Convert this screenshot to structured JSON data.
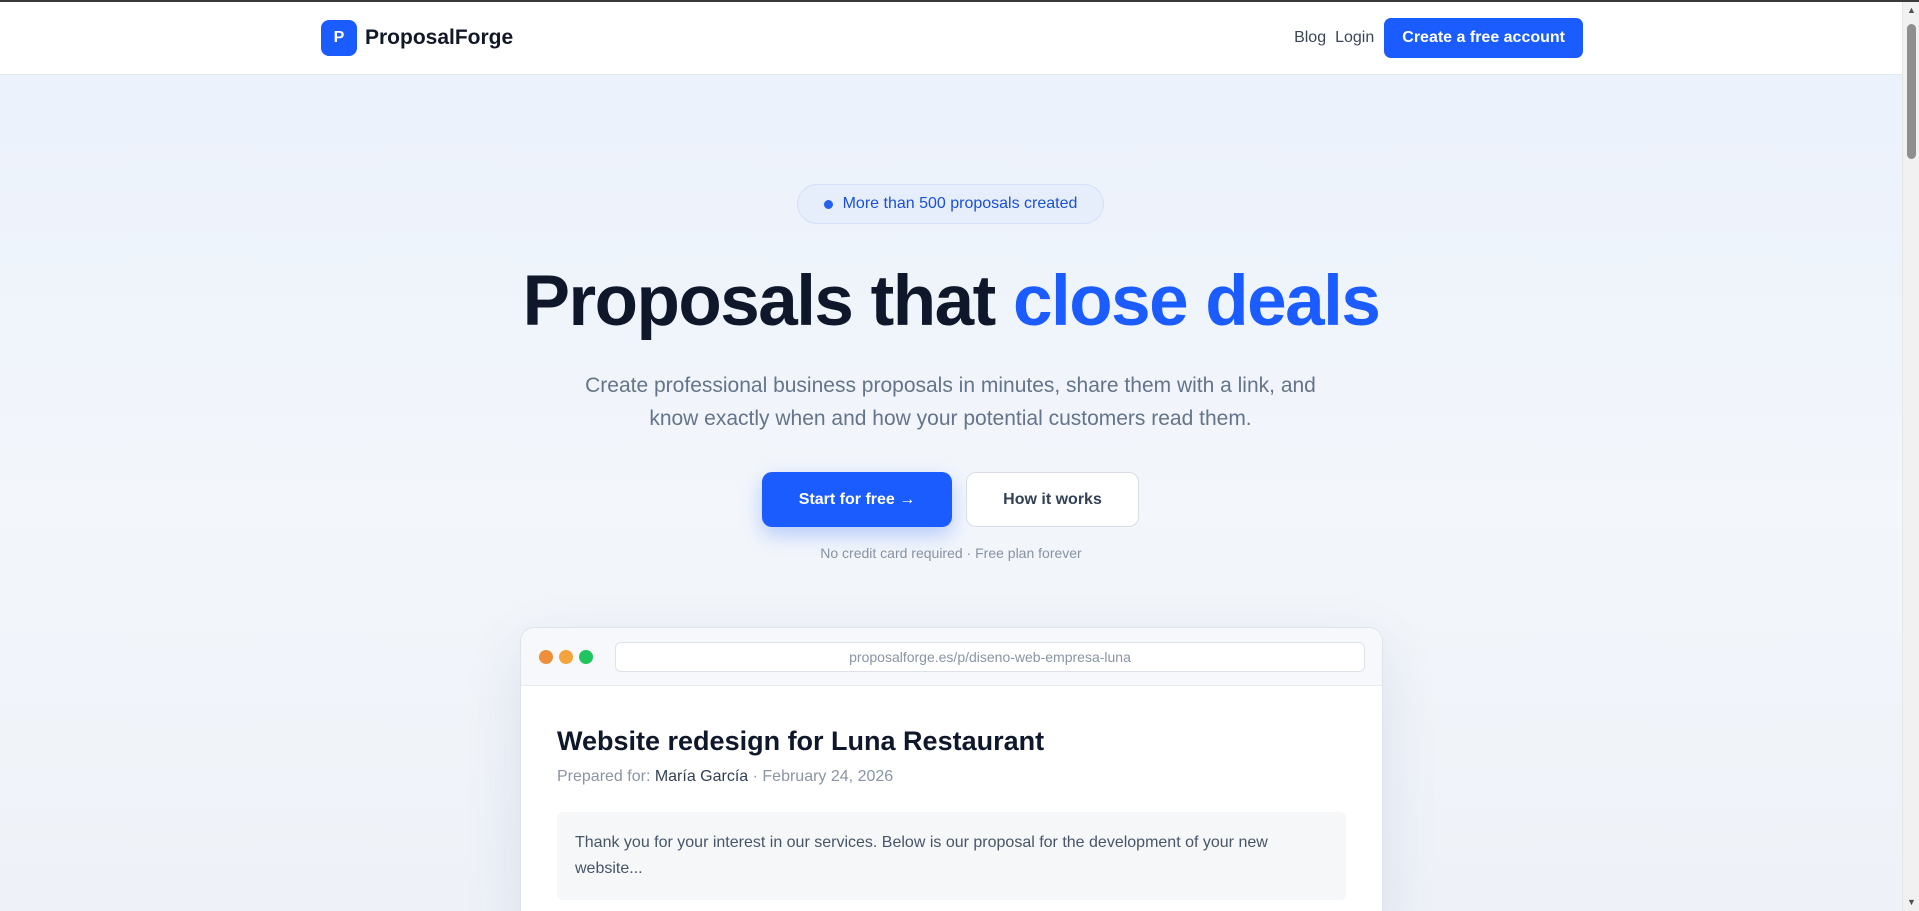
{
  "header": {
    "logo_letter": "P",
    "brand": "ProposalForge",
    "nav": {
      "blog": "Blog",
      "login": "Login",
      "cta": "Create a free account"
    }
  },
  "hero": {
    "badge": "More than 500 proposals created",
    "headline_main": "Proposals that ",
    "headline_accent": "close deals",
    "subtitle": "Create professional business proposals in minutes, share them with a link, and know exactly when and how your potential customers read them.",
    "primary_button": "Start for free →",
    "secondary_button": "How it works",
    "fineprint": "No credit card required · Free plan forever"
  },
  "preview": {
    "url": "proposalforge.es/p/diseno-web-empresa-luna",
    "title": "Website redesign for Luna Restaurant",
    "meta_label": "Prepared for: ",
    "client_name": "María García",
    "meta_date": " · February 24, 2026",
    "intro": "Thank you for your interest in our services. Below is our proposal for the development of your new website..."
  },
  "colors": {
    "accent": "#1a5cff",
    "heading": "#0f172a",
    "muted": "#64748b"
  },
  "icons": {
    "scroll_up": "triangle-up-icon",
    "scroll_down": "triangle-down-icon"
  }
}
